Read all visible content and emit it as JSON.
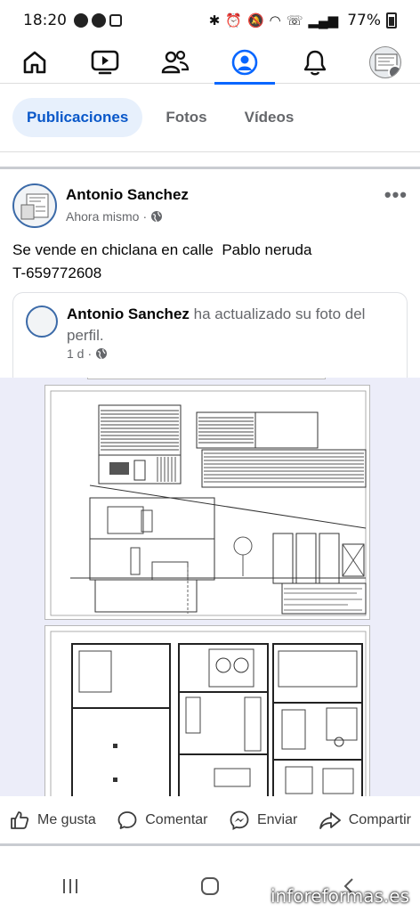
{
  "status_bar": {
    "time": "18:20",
    "battery": "77%"
  },
  "nav": {
    "items": [
      "home-icon",
      "video-icon",
      "friends-icon",
      "profile-icon",
      "notifications-icon",
      "menu-avatar"
    ]
  },
  "tabs": [
    {
      "label": "Publicaciones",
      "active": true
    },
    {
      "label": "Fotos",
      "active": false
    },
    {
      "label": "Vídeos",
      "active": false
    }
  ],
  "post": {
    "author": "Antonio Sanchez",
    "time": "Ahora mismo",
    "text_line1": "Se vende en chiclana en calle  Pablo neruda",
    "text_line2": "T-659772608",
    "more": "•••"
  },
  "shared": {
    "author": "Antonio Sanchez",
    "action": " ha actualizado su foto del perfil.",
    "time": "1 d"
  },
  "actions": {
    "like": "Me gusta",
    "comment": "Comentar",
    "send": "Enviar",
    "share": "Compartir"
  },
  "watermark": "inforeformas.es",
  "colors": {
    "accent": "#0866ff",
    "tab_active_bg": "#e7f0fc",
    "image_bg": "#ecedf9"
  }
}
